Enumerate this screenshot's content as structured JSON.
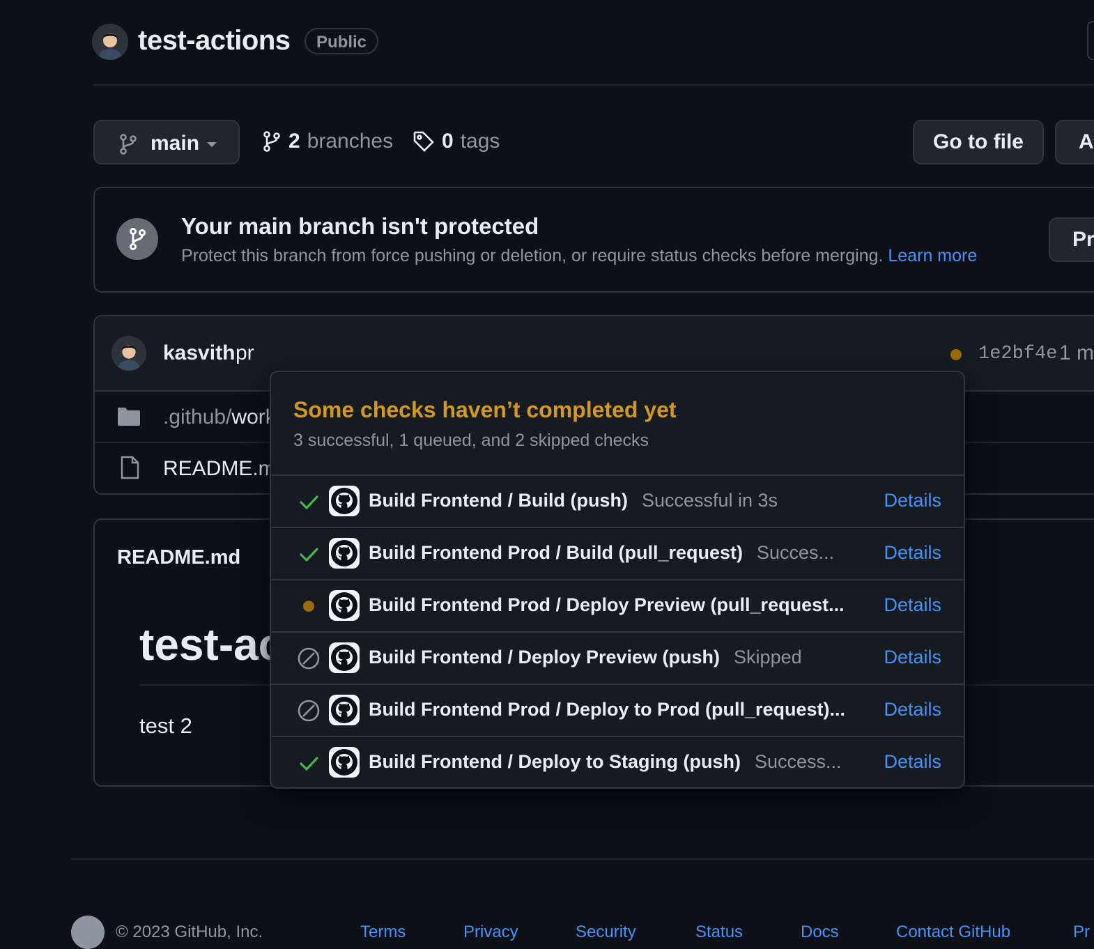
{
  "repo": {
    "name": "test-actions",
    "visibility": "Public"
  },
  "toolbar": {
    "branch": "main",
    "branches_count": "2",
    "branches_label": "branches",
    "tags_count": "0",
    "tags_label": "tags",
    "go_to_file": "Go to file",
    "add_file_partial": "A"
  },
  "protection": {
    "title": "Your main branch isn't protected",
    "description": "Protect this branch from force pushing or deletion, or require status checks before merging.",
    "learn_more": "Learn more",
    "button_partial": "Pr"
  },
  "commit": {
    "author": "kasvith",
    "message": "pr",
    "sha": "1e2bf4e",
    "time_partial": "1 mi"
  },
  "files": [
    {
      "prefix": ".github/",
      "name": "work",
      "type": "folder"
    },
    {
      "prefix": "",
      "name": "README.mc",
      "type": "file"
    }
  ],
  "readme": {
    "label": "README.md",
    "heading": "test-ac",
    "paragraph": "test 2"
  },
  "checks_popover": {
    "title": "Some checks haven’t completed yet",
    "summary": "3 successful, 1 queued, and 2 skipped checks",
    "details_label": "Details",
    "checks": [
      {
        "name": "Build Frontend / Build (push)",
        "status_text": "Successful in 3s",
        "state": "success"
      },
      {
        "name": "Build Frontend Prod / Build (pull_request)",
        "status_text": "Succes...",
        "state": "success"
      },
      {
        "name": "Build Frontend Prod / Deploy Preview (pull_request...",
        "status_text": "",
        "state": "queued"
      },
      {
        "name": "Build Frontend / Deploy Preview (push)",
        "status_text": "Skipped",
        "state": "skipped"
      },
      {
        "name": "Build Frontend Prod / Deploy to Prod (pull_request)...",
        "status_text": "",
        "state": "skipped"
      },
      {
        "name": "Build Frontend / Deploy to Staging (push)",
        "status_text": "Success...",
        "state": "success"
      }
    ]
  },
  "footer": {
    "copyright": "© 2023 GitHub, Inc.",
    "links": [
      "Terms",
      "Privacy",
      "Security",
      "Status",
      "Docs",
      "Contact GitHub",
      "Pr"
    ]
  },
  "colors": {
    "accent": "#4493f8",
    "warning": "#d29922",
    "success": "#3fb950",
    "queued_dot": "#9e6a03"
  }
}
